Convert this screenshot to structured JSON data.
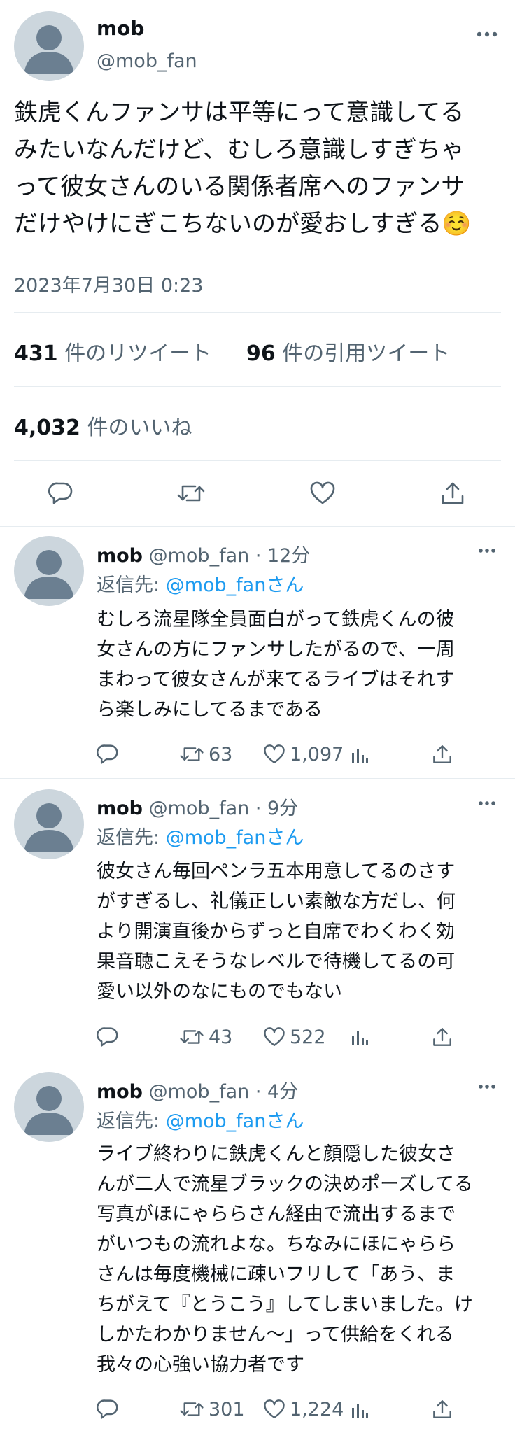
{
  "tweet": {
    "user_name": "mob",
    "handle": "@mob_fan",
    "text_lines": [
      "鉄虎くんファンサは平等にって意識してる",
      "みたいなんだけど、むしろ意識しすぎちゃ",
      "って彼女さんのいる関係者席へのファンサ",
      "だけやけにぎこちないのが愛おしすぎる☺️"
    ],
    "timestamp": "2023年7月30日 0:23",
    "retweets": "431",
    "retweets_label": "件のリツイート",
    "quotes": "96",
    "quotes_label": "件の引用ツイート",
    "likes": "4,032",
    "likes_label": "件のいいね"
  },
  "replies": [
    {
      "user_name": "mob",
      "handle_time": "@mob_fan · 12分",
      "reply_to_label": "返信先:",
      "reply_to_handle": "@mob_fanさん",
      "text_lines": [
        "むしろ流星隊全員面白がって鉄虎くんの彼",
        "女さんの方にファンサしたがるので、一周",
        "まわって彼女さんが来てるライブはそれす",
        "ら楽しみにしてるまである"
      ],
      "retweets": "63",
      "likes": "1,097"
    },
    {
      "user_name": "mob",
      "handle_time": "@mob_fan · 9分",
      "reply_to_label": "返信先:",
      "reply_to_handle": "@mob_fanさん",
      "text_lines": [
        "彼女さん毎回ペンラ五本用意してるのさす",
        "がすぎるし、礼儀正しい素敵な方だし、何",
        "より開演直後からずっと自席でわくわく効",
        "果音聴こえそうなレベルで待機してるの可",
        "愛い以外のなにものでもない"
      ],
      "retweets": "43",
      "likes": "522"
    },
    {
      "user_name": "mob",
      "handle_time": "@mob_fan · 4分",
      "reply_to_label": "返信先:",
      "reply_to_handle": "@mob_fanさん",
      "text_lines": [
        "ライブ終わりに鉄虎くんと顔隠した彼女さ",
        "んが二人で流星ブラックの決めポーズしてる",
        "写真がほにゃららさん経由で流出するまで",
        "がいつもの流れよな。ちなみにほにゃらら",
        "さんは毎度機械に疎いフリして「あう、ま",
        "ちがえて『とうこう』してしまいました。け",
        "しかたわかりません〜」って供給をくれる",
        "我々の心強い協力者です"
      ],
      "retweets": "301",
      "likes": "1,224"
    }
  ]
}
